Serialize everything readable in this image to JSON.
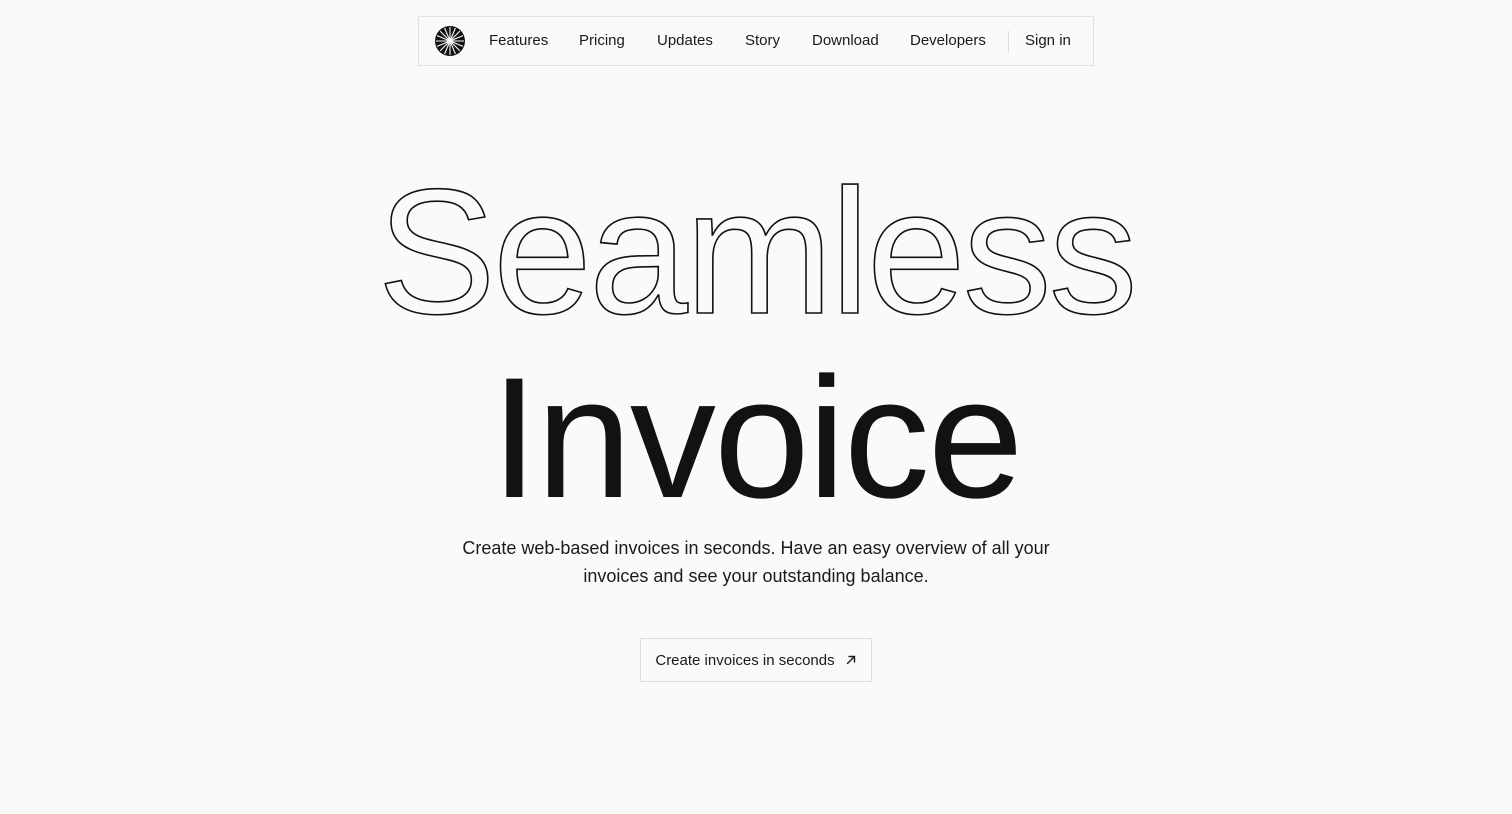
{
  "nav": {
    "logo_icon": "sunburst-logo-icon",
    "links": [
      {
        "label": "Features"
      },
      {
        "label": "Pricing"
      },
      {
        "label": "Updates"
      },
      {
        "label": "Story"
      },
      {
        "label": "Download"
      },
      {
        "label": "Developers"
      }
    ],
    "sign_in": "Sign in"
  },
  "hero": {
    "outline_word": "Seamless",
    "solid_word": "Invoice",
    "subtitle": "Create web-based invoices in seconds. Have an easy overview of all your invoices and see your outstanding balance."
  },
  "cta": {
    "label": "Create invoices in seconds",
    "icon": "arrow-up-right-icon"
  },
  "colors": {
    "background": "#fafafa",
    "text": "#121212",
    "border": "#dcdcdc"
  }
}
